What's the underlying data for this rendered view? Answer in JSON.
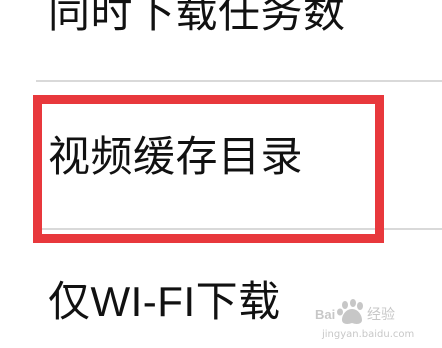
{
  "settings": {
    "items": [
      {
        "label": "同时下载任务数"
      },
      {
        "label": "视频缓存目录"
      },
      {
        "label": "仅WI-FI下载"
      }
    ]
  },
  "highlight": {
    "color": "#e8383c",
    "target": "视频缓存目录"
  },
  "watermark": {
    "text": "Baidu 经验",
    "url": "jingyan.baidu.com"
  }
}
